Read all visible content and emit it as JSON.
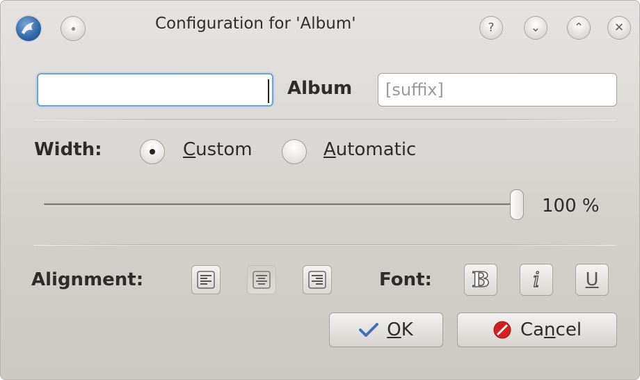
{
  "window": {
    "title": "Configuration for 'Album'",
    "titlebar_buttons": [
      {
        "name": "help",
        "glyph": "?"
      },
      {
        "name": "minimize",
        "glyph": "⌄"
      },
      {
        "name": "maximize",
        "glyph": "⌃"
      },
      {
        "name": "close",
        "glyph": "✕"
      }
    ]
  },
  "header_row": {
    "prefix_value": "",
    "label": "Album",
    "suffix_placeholder": "[suffix]"
  },
  "width": {
    "label": "Width:",
    "options": [
      {
        "label_first": "C",
        "label_rest": "ustom",
        "checked": true
      },
      {
        "label_first": "A",
        "label_rest": "utomatic",
        "checked": false
      }
    ],
    "slider_percent": 100,
    "slider_text": "100 %"
  },
  "alignment": {
    "label": "Alignment:",
    "buttons": [
      {
        "name": "align-left",
        "pressed": false
      },
      {
        "name": "align-center",
        "pressed": true
      },
      {
        "name": "align-right",
        "pressed": false
      }
    ]
  },
  "font": {
    "label": "Font:",
    "buttons": [
      {
        "name": "bold",
        "glyph": "B"
      },
      {
        "name": "italic",
        "glyph": "i"
      },
      {
        "name": "underline",
        "glyph": "U"
      }
    ]
  },
  "dialog_buttons": {
    "ok_first": "O",
    "ok_rest": "K",
    "cancel_pre": "Ca",
    "cancel_mnemonic": "n",
    "cancel_post": "cel"
  },
  "colors": {
    "focus_ring": "#6fa3d8",
    "ok_icon": "#3f6fb6",
    "cancel_icon": "#d32121"
  }
}
